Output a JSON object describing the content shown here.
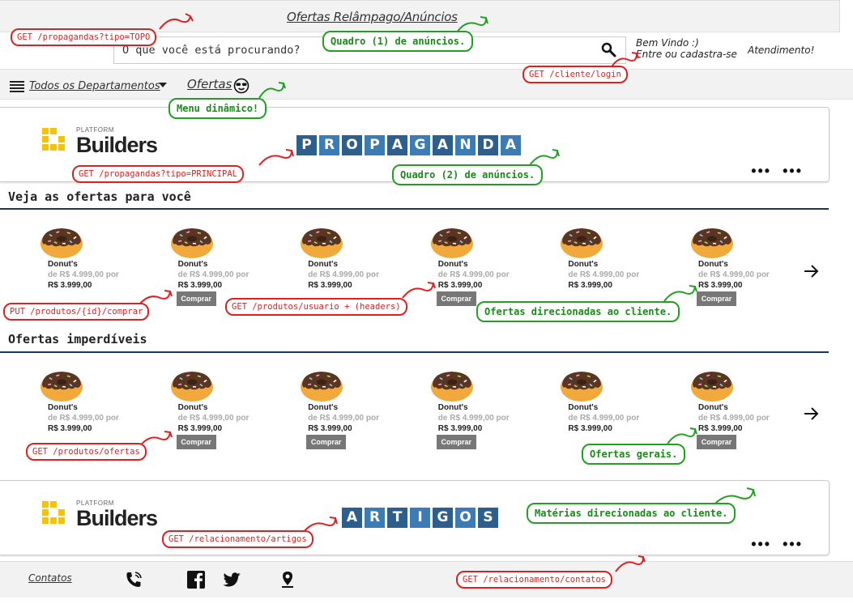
{
  "header": {
    "top_banner_title": "Ofertas Relâmpago/Anúncios",
    "search_placeholder": "O que você está procurando?",
    "welcome_line1": "Bem Vindo :)",
    "welcome_line2": "Entre ou cadastra-se",
    "support_label": "Atendimento!"
  },
  "menu": {
    "departments_label": "Todos os Departamentos",
    "offers_label": "Ofertas"
  },
  "banners": [
    {
      "logo_small": "PLATFORM",
      "logo_main": "Builders",
      "word": [
        "P",
        "R",
        "O",
        "P",
        "A",
        "G",
        "A",
        "N",
        "D",
        "A"
      ],
      "dots": [
        "•••",
        "•••"
      ]
    },
    {
      "logo_small": "PLATFORM",
      "logo_main": "Builders",
      "word": [
        "A",
        "R",
        "T",
        "I",
        "G",
        "O",
        "S"
      ],
      "dots": [
        "•••",
        "•••"
      ]
    }
  ],
  "sections": [
    {
      "title": "Veja as ofertas para você",
      "products": [
        {
          "name": "Donut's",
          "old_price": "de R$ 4.999,00 por",
          "new_price": "R$ 3.999,00",
          "button": ""
        },
        {
          "name": "Donut's",
          "old_price": "de R$ 4.999,00 por",
          "new_price": "R$ 3.999,00",
          "button": "Comprar"
        },
        {
          "name": "Donut's",
          "old_price": "de R$ 4.999,00 por",
          "new_price": "R$ 3.999,00",
          "button": ""
        },
        {
          "name": "Donut's",
          "old_price": "de R$ 4.999,00 por",
          "new_price": "R$ 3.999,00",
          "button": "Comprar"
        },
        {
          "name": "Donut's",
          "old_price": "de R$ 4.999,00 por",
          "new_price": "R$ 3.999,00",
          "button": ""
        },
        {
          "name": "Donut's",
          "old_price": "de R$ 4.999,00 por",
          "new_price": "R$ 3.999,00",
          "button": "Comprar"
        }
      ]
    },
    {
      "title": "Ofertas imperdíveis",
      "products": [
        {
          "name": "Donut's",
          "old_price": "de R$ 4.999,00 por",
          "new_price": "R$ 3.999,00",
          "button": ""
        },
        {
          "name": "Donut's",
          "old_price": "de R$ 4.999,00 por",
          "new_price": "R$ 3.999,00",
          "button": "Comprar"
        },
        {
          "name": "Donut's",
          "old_price": "de R$ 4.999,00 por",
          "new_price": "R$ 3.999,00",
          "button": "Comprar"
        },
        {
          "name": "Donut's",
          "old_price": "de R$ 4.999,00 por",
          "new_price": "R$ 3.999,00",
          "button": "Comprar"
        },
        {
          "name": "Donut's",
          "old_price": "de R$ 4.999,00 por",
          "new_price": "R$ 3.999,00",
          "button": ""
        },
        {
          "name": "Donut's",
          "old_price": "de R$ 4.999,00 por",
          "new_price": "R$ 3.999,00",
          "button": "Comprar"
        }
      ]
    }
  ],
  "footer": {
    "contacts_label": "Contatos",
    "icons": [
      "phone-icon",
      "facebook-icon",
      "twitter-icon",
      "location-pin-icon"
    ]
  },
  "annotations": {
    "get_topo": "GET /propagandas?tipo=TOPO",
    "quadro1": "Quadro (1) de anúncios.",
    "get_login": "GET /cliente/login",
    "menu_dinamico": "Menu dinâmico!",
    "get_principal": "GET /propagandas?tipo=PRINCIPAL",
    "quadro2": "Quadro (2) de anúncios.",
    "put_comprar": "PUT /produtos/{id}/comprar",
    "get_usuario": "GET /produtos/usuario + (headers)",
    "ofertas_direcionadas": "Ofertas direcionadas ao cliente.",
    "get_ofertas": "GET /produtos/ofertas",
    "ofertas_gerais": "Ofertas gerais.",
    "materias": "Matérias direcionadas ao cliente.",
    "get_artigos": "GET /relacionamento/artigos",
    "get_contatos": "GET /relacionamento/contatos"
  },
  "colors": {
    "tile_dark": "#2e5f8c",
    "tile_light": "#3d7bb5",
    "section_rule": "#1d3460",
    "logo_yellow": "#f5c300",
    "annotation_red": "#e02020",
    "annotation_green": "#22a022",
    "button_gray": "#777777"
  }
}
